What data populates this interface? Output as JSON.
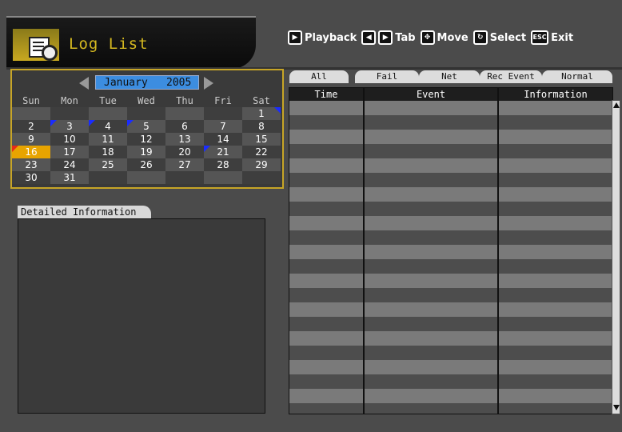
{
  "title": "Log List",
  "hints": [
    {
      "keys": [
        "play-key-icon"
      ],
      "label": "Playback"
    },
    {
      "keys": [
        "prev-track-key-icon",
        "next-track-key-icon"
      ],
      "label": "Tab"
    },
    {
      "keys": [
        "move-key-icon"
      ],
      "label": "Move"
    },
    {
      "keys": [
        "select-key-icon"
      ],
      "label": "Select"
    },
    {
      "keys": [
        "esc-key-icon"
      ],
      "label": "Exit",
      "key_text": "ESC"
    }
  ],
  "calendar": {
    "month": "January",
    "year": "2005",
    "weekdays": [
      "Sun",
      "Mon",
      "Tue",
      "Wed",
      "Thu",
      "Fri",
      "Sat"
    ],
    "weeks": [
      [
        "",
        "",
        "",
        "",
        "",
        "",
        "1"
      ],
      [
        "2",
        "3",
        "4",
        "5",
        "6",
        "7",
        "8"
      ],
      [
        "9",
        "10",
        "11",
        "12",
        "13",
        "14",
        "15"
      ],
      [
        "16",
        "17",
        "18",
        "19",
        "20",
        "21",
        "22"
      ],
      [
        "23",
        "24",
        "25",
        "26",
        "27",
        "28",
        "29"
      ],
      [
        "30",
        "31",
        "",
        "",
        "",
        "",
        ""
      ]
    ],
    "selected_day": "16",
    "event_days": [
      "1",
      "3",
      "4",
      "5",
      "16",
      "21"
    ],
    "colors": {
      "event_flag": "#1a2cff",
      "selected_flag": "#e82b18",
      "selected_bg": "#e8a400",
      "month_box": "#3c8de0",
      "frame": "#c7a526"
    }
  },
  "detail": {
    "title": "Detailed Information"
  },
  "log": {
    "tabs": [
      "All",
      "Fail",
      "Net",
      "Rec Event",
      "Normal"
    ],
    "active_tab": "All",
    "columns": [
      "Time",
      "Event",
      "Information"
    ],
    "row_count": 22
  }
}
